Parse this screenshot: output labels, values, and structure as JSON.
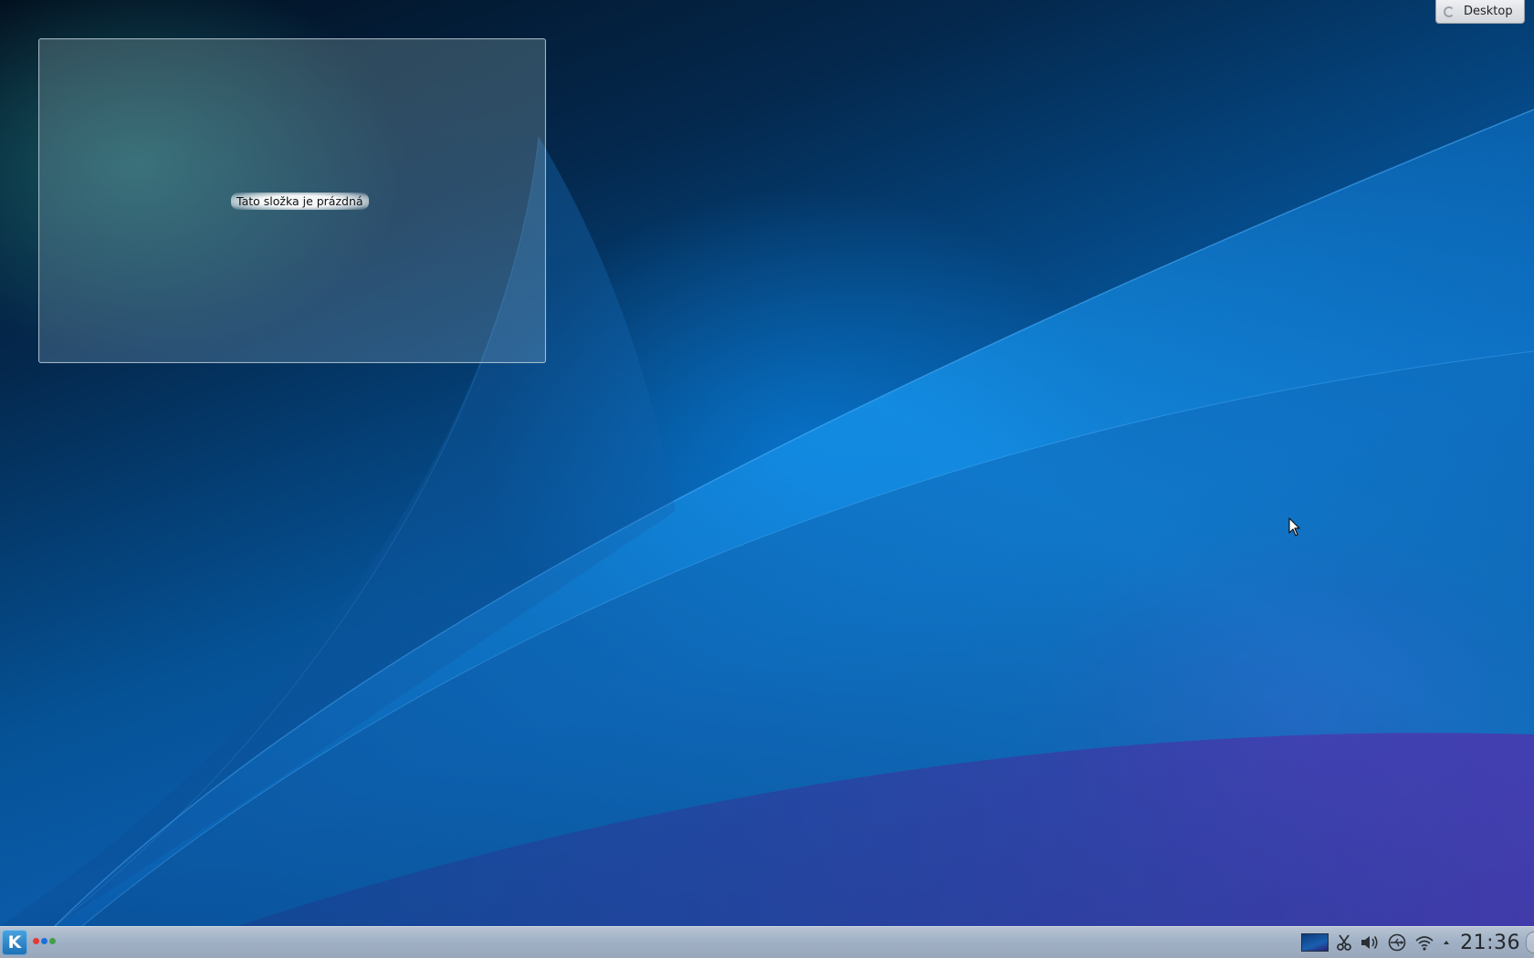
{
  "toolbox": {
    "label": "Desktop"
  },
  "folder_view": {
    "empty_message": "Tato složka je prázdná"
  },
  "panel": {
    "menu_icon": "kde-application-launcher-icon",
    "pager_dots": [
      "#e53935",
      "#1e6fd9",
      "#43a047"
    ],
    "tray_icons": [
      "network-thumbnail-icon",
      "clipboard-scissors-icon",
      "volume-icon",
      "usb-device-icon",
      "wifi-icon",
      "tray-expand-arrow-icon"
    ],
    "clock": "21:36"
  }
}
